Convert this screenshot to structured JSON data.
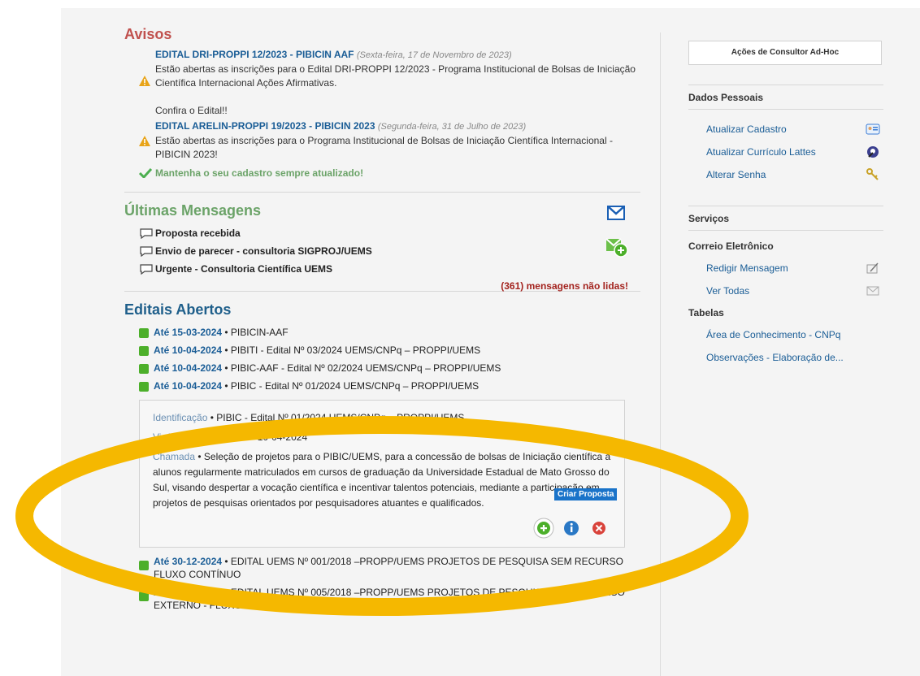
{
  "avisos": {
    "title": "Avisos",
    "items": [
      {
        "link": "EDITAL DRI-PROPPI 12/2023 - PIBICIN AAF",
        "date": "(Sexta-feira, 17 de Novembro de 2023)",
        "text": "Estão abertas as inscrições para o Edital DRI-PROPPI 12/2023 - Programa Institucional de Bolsas de Iniciação Científica Internacional Ações Afirmativas.",
        "extra": "Confira o Edital!!"
      },
      {
        "link": "EDITAL ARELIN-PROPPI 19/2023 - PIBICIN 2023",
        "date": "(Segunda-feira, 31 de Julho de 2023)",
        "text": "Estão abertas as inscrições para o Programa Institucional de Bolsas de Iniciação Científica Internacional - PIBICIN 2023!"
      }
    ],
    "keep_updated": "Mantenha o seu cadastro sempre atualizado!"
  },
  "mensagens": {
    "title": "Últimas Mensagens",
    "items": [
      "Proposta recebida",
      "Envio de parecer - consultoria SIGPROJ/UEMS",
      "Urgente - Consultoria Científica UEMS"
    ],
    "unread": "(361) mensagens não lidas!"
  },
  "editais": {
    "title": "Editais Abertos",
    "list_top": [
      {
        "date": "Até 15-03-2024",
        "text": " • PIBICIN-AAF"
      },
      {
        "date": "Até 10-04-2024",
        "text": " • PIBITI - Edital Nº 03/2024 UEMS/CNPq – PROPPI/UEMS"
      },
      {
        "date": "Até 10-04-2024",
        "text": " • PIBIC-AAF - Edital Nº 02/2024 UEMS/CNPq – PROPPI/UEMS"
      },
      {
        "date": "Até 10-04-2024",
        "text": " • PIBIC - Edital Nº 01/2024 UEMS/CNPq – PROPPI/UEMS"
      }
    ],
    "detail": {
      "identificacao_label": "Identificação",
      "identificacao": " • PIBIC - Edital Nº 01/2024 UEMS/CNPq – PROPPI/UEMS",
      "vigencia_label": "Vigência",
      "vigencia": " • 29-02-2024 - 10-04-2024",
      "chamada_label": "Chamada",
      "chamada": " • Seleção de projetos para o PIBIC/UEMS, para a concessão de bolsas de Iniciação científica a alunos regularmente matriculados em cursos de graduação da Universidade Estadual de Mato Grosso do Sul, visando despertar a vocação científica e incentivar talentos potenciais, mediante a participação em projetos de pesquisas orientados por pesquisadores atuantes e qualificados.",
      "criar_proposta": "Criar Proposta"
    },
    "list_bottom": [
      {
        "date": "Até 30-12-2024",
        "text": " • EDITAL UEMS Nº 001/2018 –PROPP/UEMS PROJETOS DE PESQUISA SEM RECURSO FLUXO CONTÍNUO"
      },
      {
        "date": "Até 30-12-2024",
        "text": " • EDITAL UEMS Nº 005/2018 –PROPP/UEMS PROJETOS DE PESQUISA COM RECURSO EXTERNO - FLUXO CONTÍNUO"
      }
    ]
  },
  "sidebar": {
    "consultor_button": "Ações de Consultor Ad-Hoc",
    "dados_pessoais": "Dados Pessoais",
    "dados_items": [
      "Atualizar Cadastro",
      "Atualizar Currículo Lattes",
      "Alterar Senha"
    ],
    "servicos": "Serviços",
    "correio": "Correio Eletrônico",
    "correio_items": [
      "Redigir Mensagem",
      "Ver Todas"
    ],
    "tabelas": "Tabelas",
    "tabelas_items": [
      "Área de Conhecimento - CNPq",
      "Observações - Elaboração de..."
    ]
  },
  "colors": {
    "link": "#1a5d96",
    "avisos_title": "#c0504d",
    "messages_title": "#6ba368",
    "editais_title": "#1f5f8b",
    "unread": "#a3231e",
    "highlight_ellipse": "#f5b800"
  }
}
